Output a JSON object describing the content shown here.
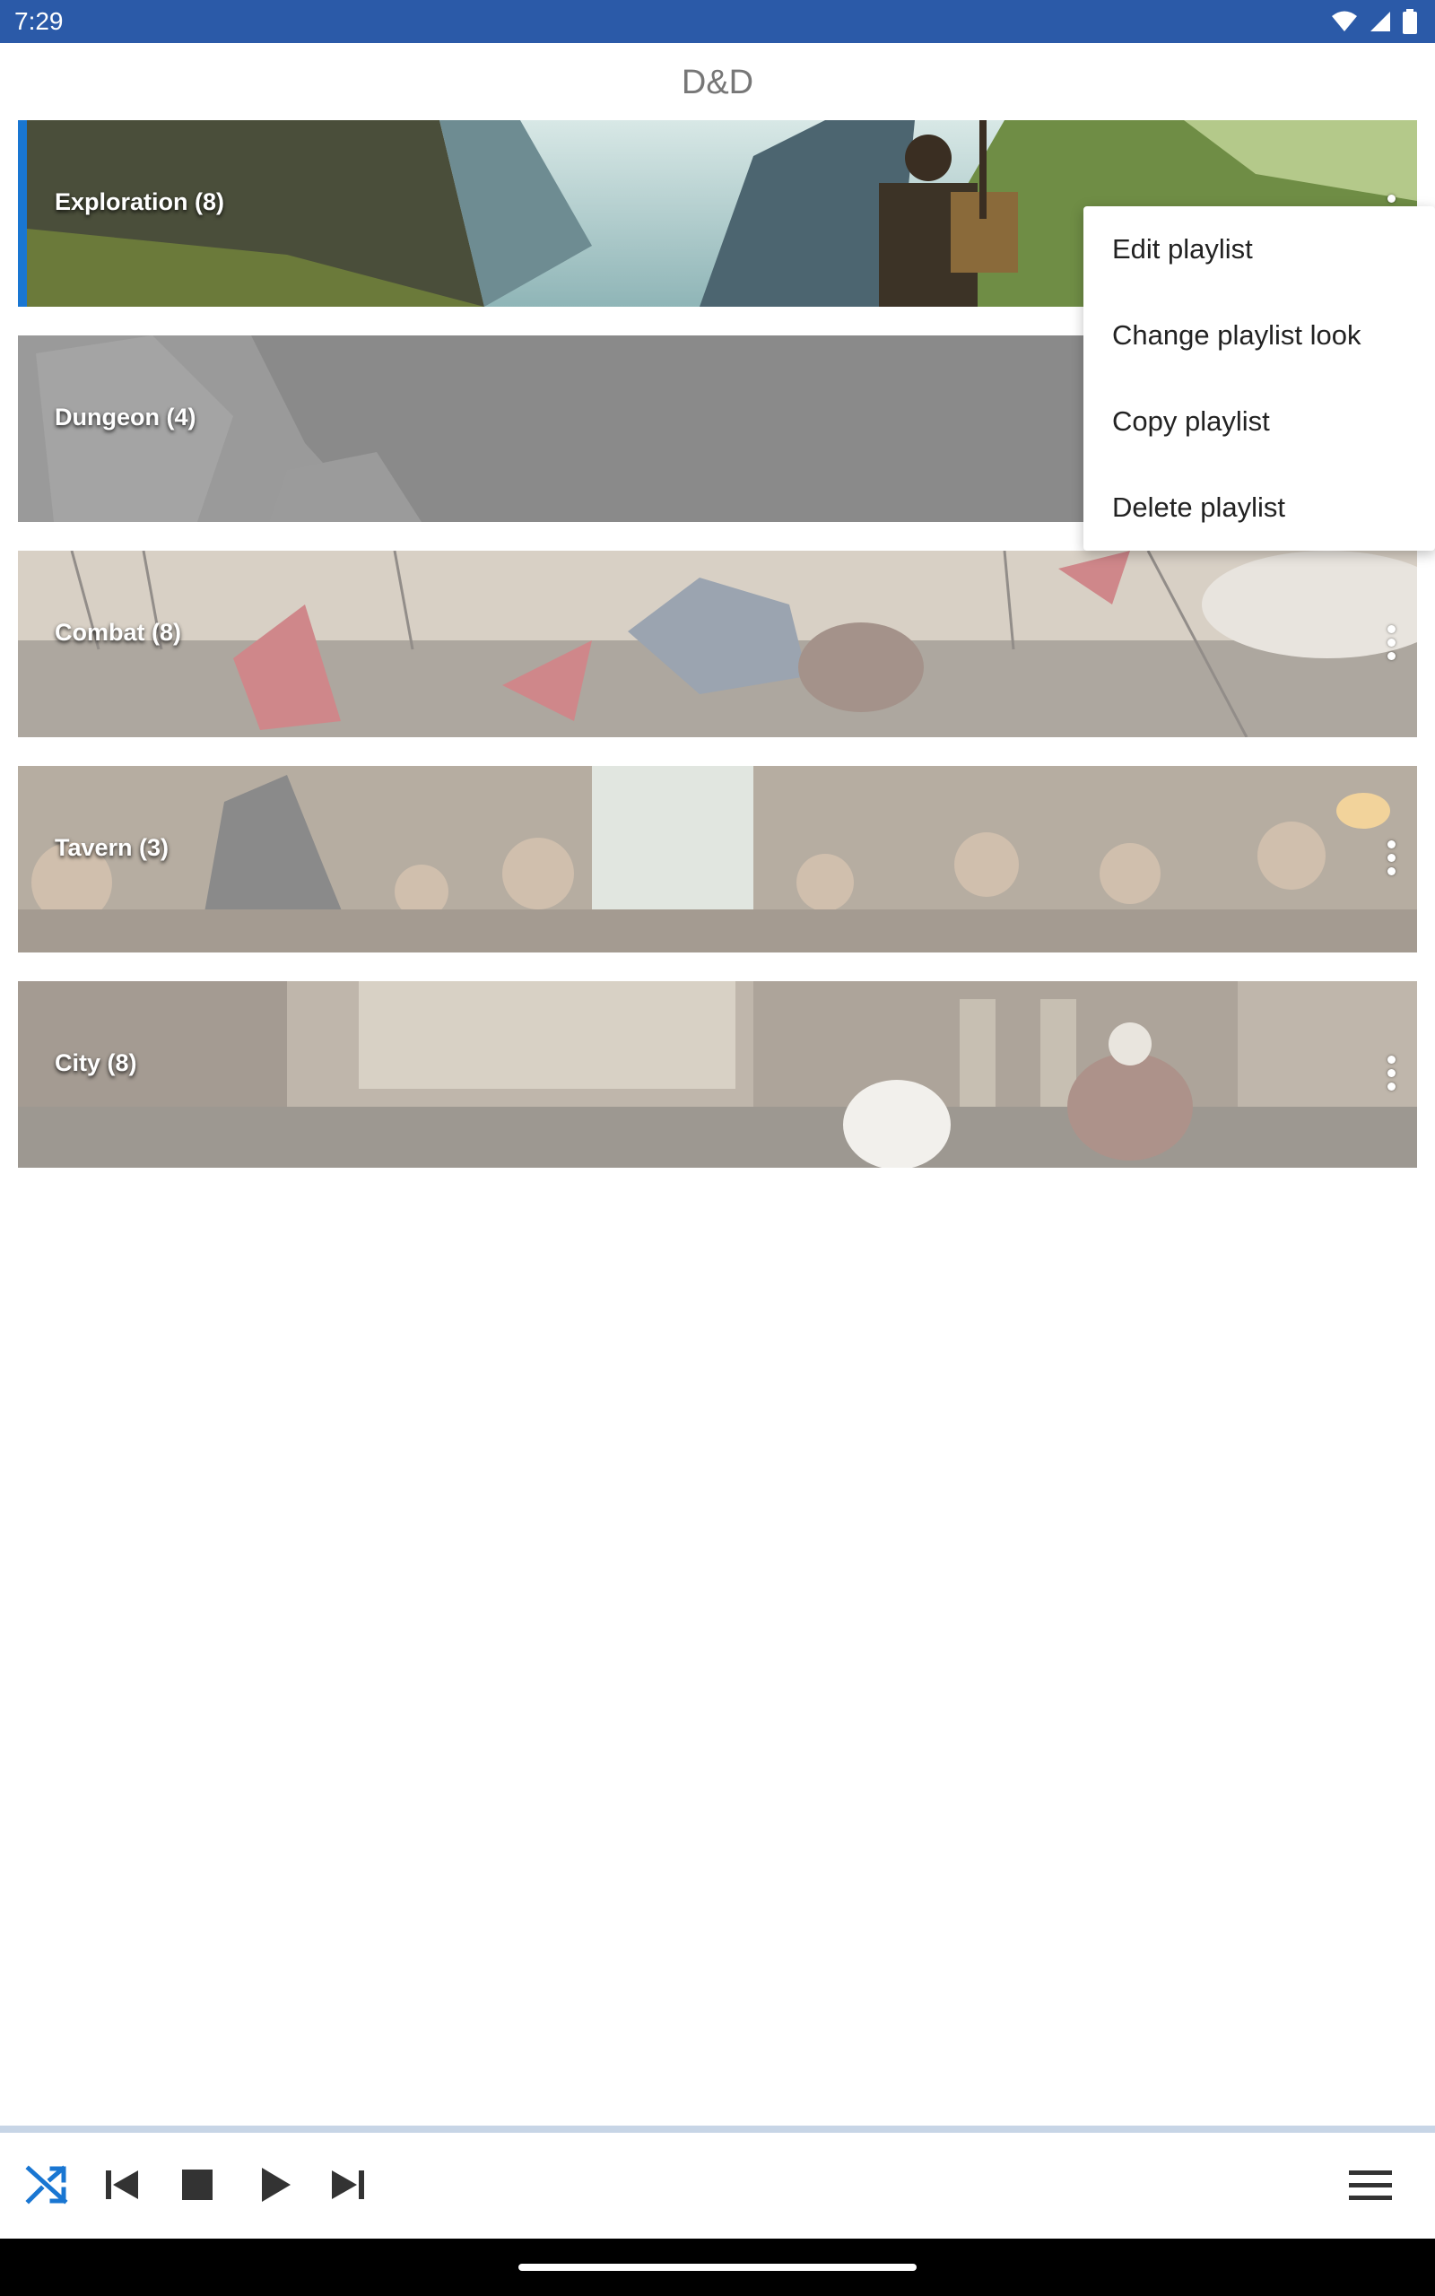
{
  "status": {
    "time": "7:29"
  },
  "title": "D&D",
  "playlists": [
    {
      "label": "Exploration (8)",
      "selected": true
    },
    {
      "label": "Dungeon (4)",
      "selected": false
    },
    {
      "label": "Combat (8)",
      "selected": false
    },
    {
      "label": "Tavern (3)",
      "selected": false
    },
    {
      "label": "City (8)",
      "selected": false
    }
  ],
  "menu": {
    "items": [
      "Edit playlist",
      "Change playlist look",
      "Copy playlist",
      "Delete playlist"
    ]
  },
  "player": {
    "buttons": [
      "shuffle-icon",
      "skip-previous-icon",
      "stop-icon",
      "play-icon",
      "skip-next-icon",
      "menu-icon"
    ]
  },
  "colors": {
    "statusbar": "#2b5aa8",
    "accent": "#1976d2"
  }
}
